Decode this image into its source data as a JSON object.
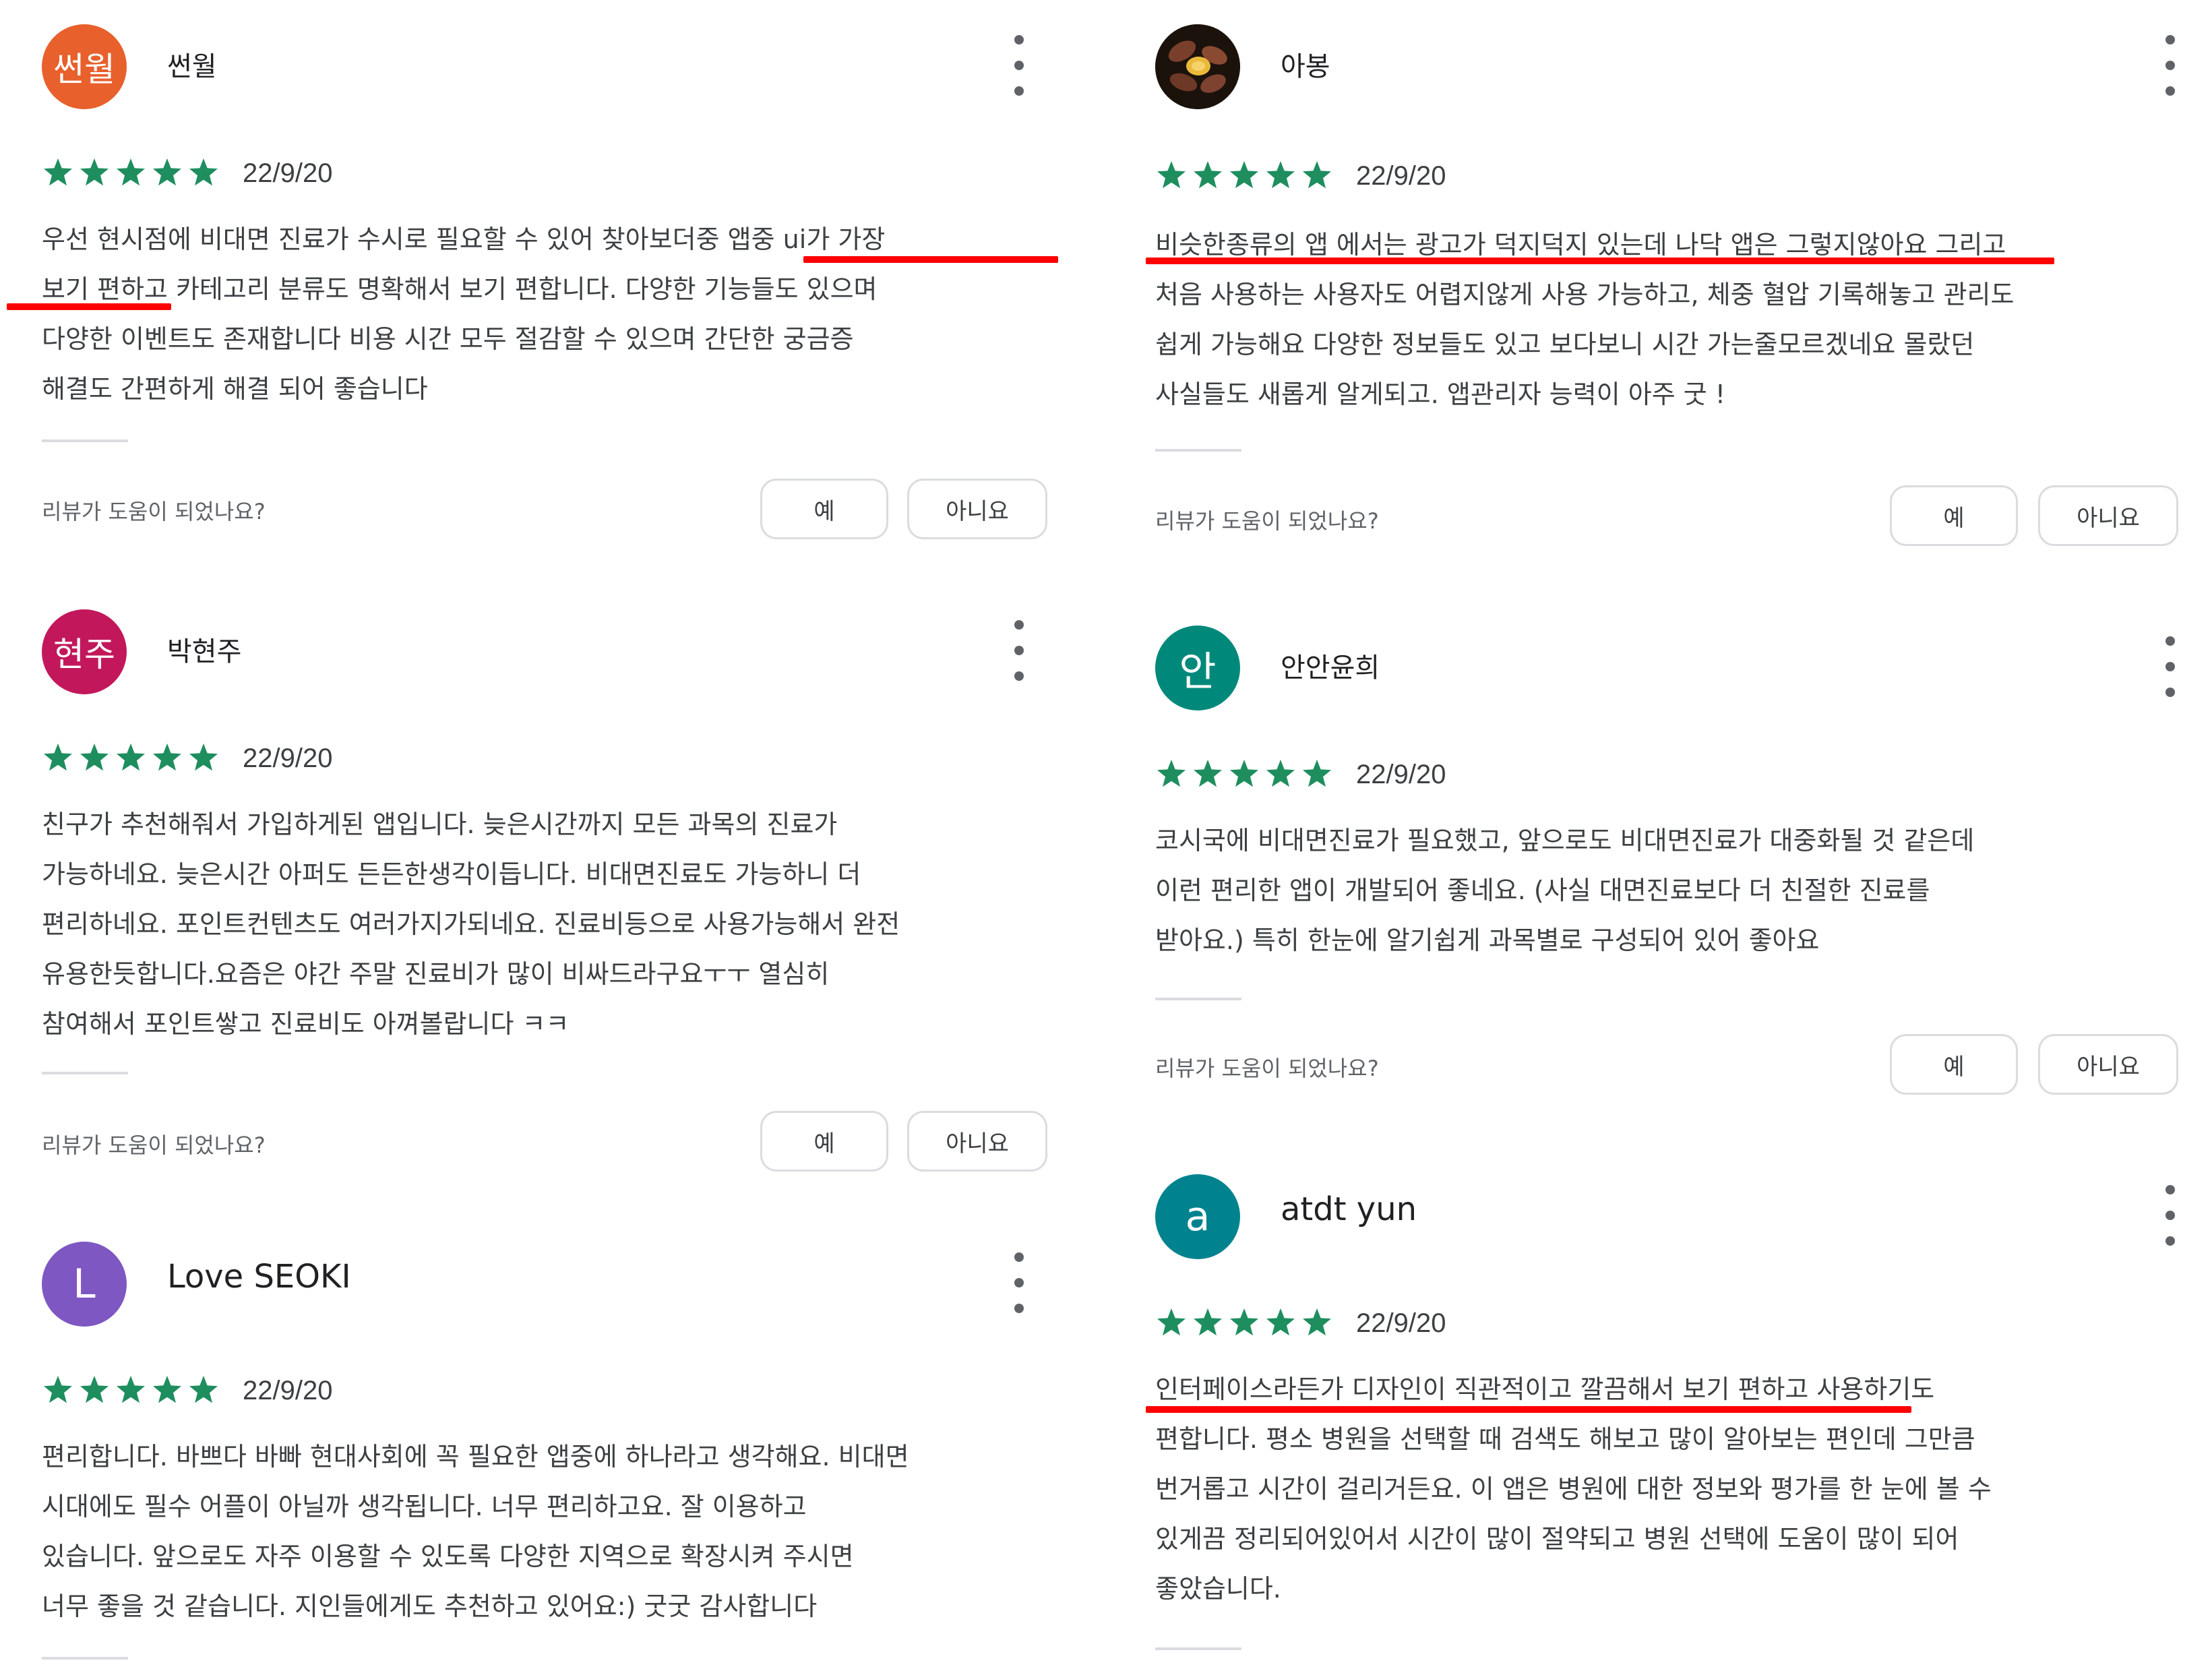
{
  "helpful_prompt": "리뷰가 도움이 되었나요?",
  "yes_label": "예",
  "no_label": "아니요",
  "star_color": "#1e8e5e",
  "reviews": [
    {
      "avatar_text": "썬월",
      "avatar_color": "#e8602c",
      "name": "썬월",
      "stars": 5,
      "date": "22/9/20",
      "text": "우선 현시점에 비대면 진료가 수시로 필요할 수 있어 찾아보더중 앱중 ui가 가장\n보기 편하고 카테고리 분류도 명확해서 보기 편합니다. 다양한 기능들도 있으며\n다양한 이벤트도 존재합니다 비용 시간 모두 절감할 수 있으며 간단한 궁금증\n해결도 간편하게 해결 되어 좋습니다"
    },
    {
      "avatar_text": "현주",
      "avatar_color": "#c2185b",
      "name": "박현주",
      "stars": 5,
      "date": "22/9/20",
      "text": "친구가 추천해줘서 가입하게된 앱입니다. 늦은시간까지 모든 과목의 진료가\n가능하네요. 늦은시간 아퍼도 든든한생각이듭니다. 비대면진료도 가능하니 더\n편리하네요. 포인트컨텐츠도 여러가지가되네요. 진료비등으로 사용가능해서 완전\n유용한듯합니다.요즘은 야간 주말 진료비가 많이 비싸드라구요ㅜㅜ 열심히\n참여해서 포인트쌓고 진료비도 아껴볼랍니다 ㅋㅋ"
    },
    {
      "avatar_text": "L",
      "avatar_color": "#7e57c2",
      "name": "Love SEOKI",
      "stars": 5,
      "date": "22/9/20",
      "text": "편리합니다. 바쁘다 바빠 현대사회에 꼭 필요한 앱중에 하나라고 생각해요. 비대면\n시대에도 필수 어플이 아닐까 생각됩니다. 너무 편리하고요. 잘 이용하고\n있습니다. 앞으로도 자주 이용할 수 있도록 다양한 지역으로 확장시켜 주시면\n너무 좋을 것 같습니다. 지인들에게도 추천하고 있어요:) 굿굿 감사합니다"
    },
    {
      "avatar_text": "",
      "avatar_color": "#2b1c12",
      "name": "아봉",
      "stars": 5,
      "date": "22/9/20",
      "text": "비슷한종류의 앱 에서는 광고가 덕지덕지 있는데 나닥 앱은 그렇지않아요 그리고\n처음 사용하는 사용자도 어렵지않게 사용 가능하고, 체중 혈압 기록해놓고 관리도\n쉽게 가능해요 다양한 정보들도 있고 보다보니 시간 가는줄모르겠네요 몰랐던\n사실들도 새롭게 알게되고. 앱관리자 능력이 아주 굿 !"
    },
    {
      "avatar_text": "안",
      "avatar_color": "#00897b",
      "name": "안안윤희",
      "stars": 5,
      "date": "22/9/20",
      "text": "코시국에 비대면진료가 필요했고, 앞으로도 비대면진료가 대중화될 것 같은데\n이런 편리한 앱이 개발되어 좋네요. (사실 대면진료보다 더 친절한 진료를\n받아요.) 특히 한눈에 알기쉽게 과목별로 구성되어 있어 좋아요"
    },
    {
      "avatar_text": "a",
      "avatar_color": "#00838f",
      "name": "atdt yun",
      "stars": 5,
      "date": "22/9/20",
      "text": "인터페이스라든가 디자인이 직관적이고 깔끔해서 보기 편하고 사용하기도\n편합니다. 평소 병원을 선택할 때 검색도 해보고 많이 알아보는 편인데 그만큼\n번거롭고 시간이 걸리거든요. 이 앱은 병원에 대한 정보와 평가를 한 눈에 볼 수\n있게끔 정리되어있어서 시간이 많이 절약되고 병원 선택에 도움이 많이 되어\n좋았습니다."
    }
  ]
}
